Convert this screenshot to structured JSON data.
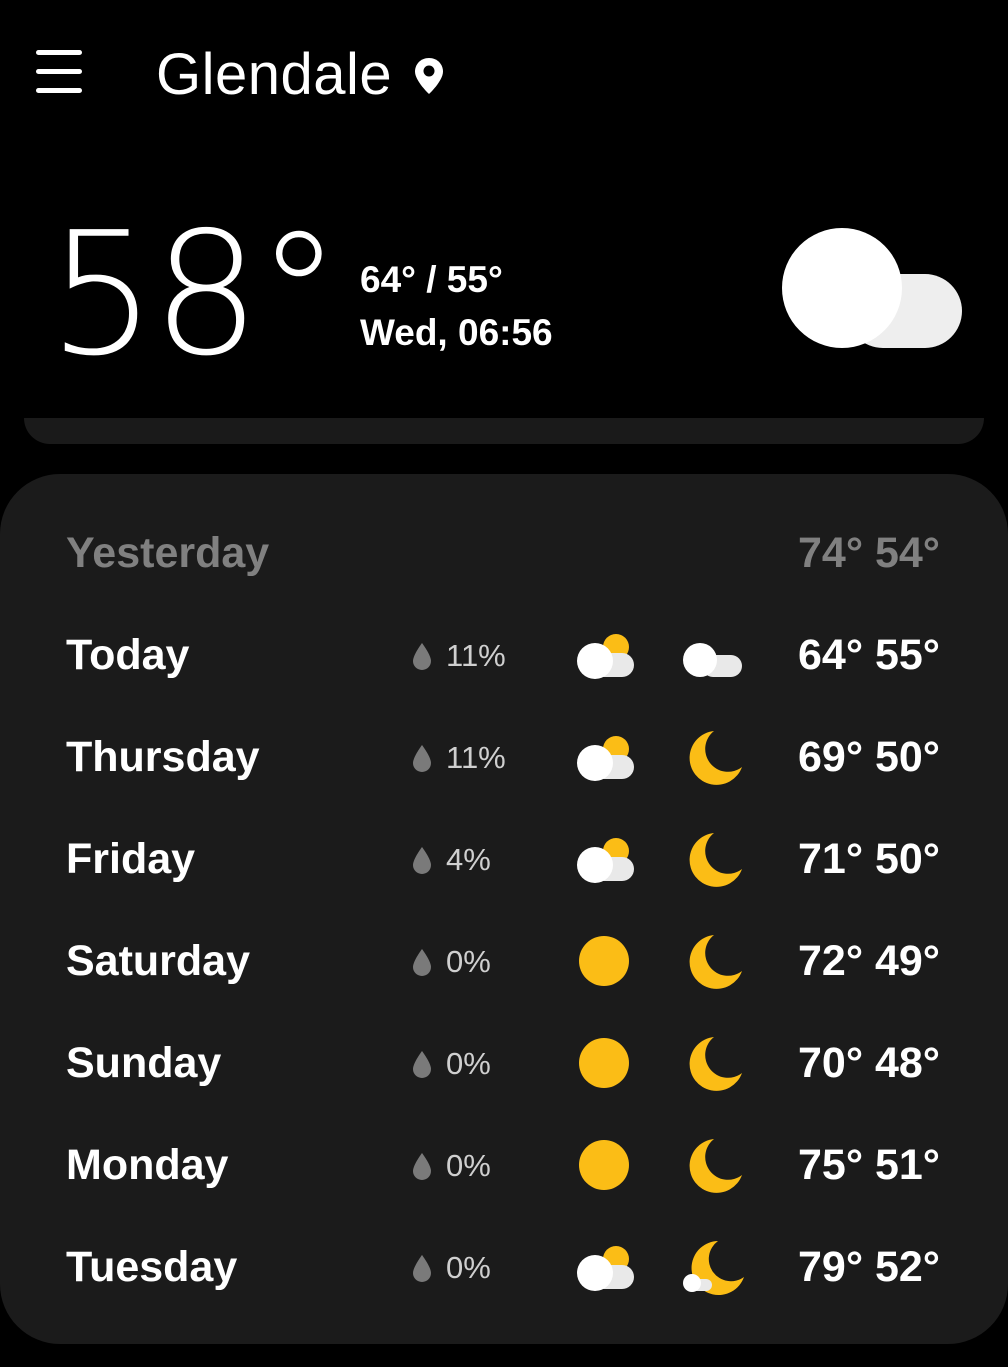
{
  "header": {
    "city": "Glendale"
  },
  "current": {
    "temperature": "58°",
    "high_low": "64° / 55°",
    "datetime": "Wed, 06:56",
    "condition_icon": "cloudy-icon"
  },
  "forecast": {
    "yesterday": {
      "day": "Yesterday",
      "temps": "74° 54°"
    },
    "days": [
      {
        "day": "Today",
        "precip": "11%",
        "day_icon": "partly-cloudy-day-icon",
        "night_icon": "cloudy-night-icon",
        "temps": "64° 55°"
      },
      {
        "day": "Thursday",
        "precip": "11%",
        "day_icon": "partly-cloudy-day-icon",
        "night_icon": "moon-icon",
        "temps": "69° 50°"
      },
      {
        "day": "Friday",
        "precip": "4%",
        "day_icon": "partly-cloudy-day-icon",
        "night_icon": "moon-icon",
        "temps": "71° 50°"
      },
      {
        "day": "Saturday",
        "precip": "0%",
        "day_icon": "sun-icon",
        "night_icon": "moon-icon",
        "temps": "72° 49°"
      },
      {
        "day": "Sunday",
        "precip": "0%",
        "day_icon": "sun-icon",
        "night_icon": "moon-icon",
        "temps": "70° 48°"
      },
      {
        "day": "Monday",
        "precip": "0%",
        "day_icon": "sun-icon",
        "night_icon": "moon-icon",
        "temps": "75° 51°"
      },
      {
        "day": "Tuesday",
        "precip": "0%",
        "day_icon": "partly-cloudy-day-icon",
        "night_icon": "partly-cloudy-night-icon",
        "temps": "79° 52°"
      }
    ]
  },
  "colors": {
    "background": "#000000",
    "card": "#1b1b1b",
    "sun": "#fbbd16",
    "cloud": "#ffffff",
    "muted_text": "#808080"
  }
}
